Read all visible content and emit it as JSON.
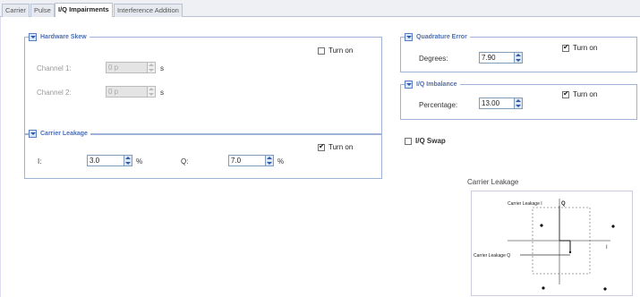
{
  "tabs": [
    {
      "label": "Carrier"
    },
    {
      "label": "Pulse"
    },
    {
      "label": "I/Q Impairments"
    },
    {
      "label": "Interference Addition"
    }
  ],
  "hardware_skew": {
    "title": "Hardware Skew",
    "turn_on_label": "Turn on",
    "turn_on_checked": false,
    "channel1_label": "Channel 1:",
    "channel1_value": "0 p",
    "channel1_unit": "s",
    "channel2_label": "Channel 2:",
    "channel2_value": "0 p",
    "channel2_unit": "s"
  },
  "carrier_leakage": {
    "title": "Carrier Leakage",
    "turn_on_label": "Turn on",
    "turn_on_checked": true,
    "i_label": "I:",
    "i_value": "3.0",
    "i_unit": "%",
    "q_label": "Q:",
    "q_value": "7.0",
    "q_unit": "%"
  },
  "quadrature_error": {
    "title": "Quadrature Error",
    "turn_on_label": "Turn on",
    "turn_on_checked": true,
    "degrees_label": "Degrees:",
    "degrees_value": "7.90"
  },
  "iq_imbalance": {
    "title": "I/Q Imbalance",
    "turn_on_label": "Turn on",
    "turn_on_checked": true,
    "percentage_label": "Percentage:",
    "percentage_value": "13.00"
  },
  "iq_swap": {
    "label": "I/Q Swap",
    "checked": false
  },
  "diagram": {
    "title": "Carrier Leakage",
    "leak_i_label": "Carrier Leakage I",
    "leak_q_label": "Carrier Leakage Q",
    "axis_q": "Q",
    "axis_i": "I"
  },
  "colors": {
    "group_border": "#9fb3d8",
    "group_title": "#4a6fb5",
    "active_tab_bg": "#ffffff"
  }
}
